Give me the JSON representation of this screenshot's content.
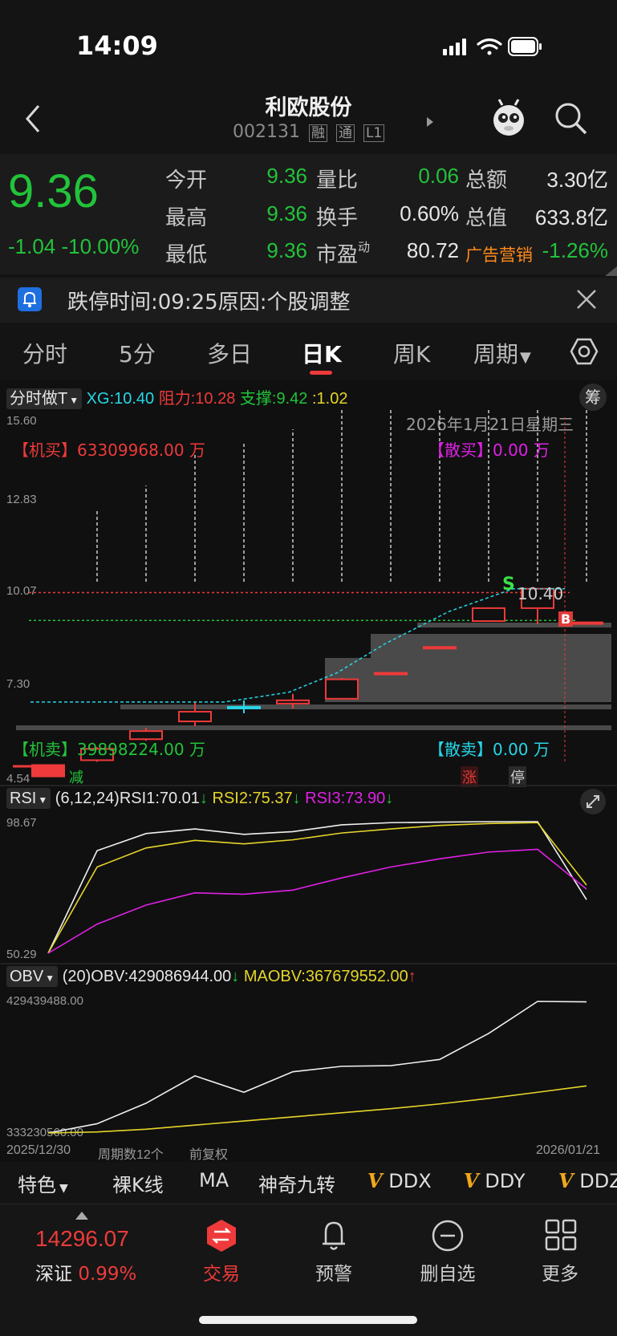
{
  "status_bar": {
    "time": "14:09"
  },
  "header": {
    "title": "利欧股份",
    "code": "002131",
    "tags": [
      "融",
      "通",
      "L1"
    ]
  },
  "quote": {
    "price": "9.36",
    "change": "-1.04",
    "change_pct": "-10.00%",
    "rows": [
      {
        "l1": "今开",
        "v1": "9.36",
        "l2": "量比",
        "v2": "0.06",
        "l3": "总额",
        "v3": "3.30亿"
      },
      {
        "l1": "最高",
        "v1": "9.36",
        "l2": "换手",
        "v2": "0.60%",
        "l3": "总值",
        "v3": "633.8亿"
      },
      {
        "l1": "最低",
        "v1": "9.36",
        "l2": "市盈",
        "l2_sup": "动",
        "v2": "80.72",
        "l3": "广告营销",
        "v3": "-1.26%"
      }
    ]
  },
  "notice": {
    "text": "跌停时间:09:25原因:个股调整"
  },
  "tabs": [
    "分时",
    "5分",
    "多日",
    "日K",
    "周K",
    "周期"
  ],
  "active_tab": "日K",
  "kline": {
    "indicator_select": "分时做T",
    "xg": "XG:10.40",
    "resist": "阻力:10.28",
    "support": "支撑:9.42",
    "ratio": ":1.02",
    "chip_button": "筹",
    "date_label": "2026年1月21日星期三",
    "y_ticks": [
      "15.60",
      "12.83",
      "10.07",
      "7.30",
      "4.54"
    ],
    "inst_buy": "【机买】63309968.00 万",
    "retail_buy": "【散买】0.00 万",
    "inst_sell": "【机卖】39898224.00 万",
    "retail_sell": "【散卖】0.00 万",
    "markers": {
      "s": "S",
      "b": "B",
      "price_tag": "10.40",
      "reduce": "减",
      "rise": "涨",
      "halt": "停"
    }
  },
  "rsi": {
    "select": "RSI",
    "params": "(6,12,24)",
    "rsi1": "RSI1:70.01",
    "rsi2": "RSI2:75.37",
    "rsi3": "RSI3:73.90",
    "y_top": "98.67",
    "y_bottom": "50.29"
  },
  "obv": {
    "select": "OBV",
    "params": "(20)",
    "obv": "OBV:429086944.00",
    "maobv": "MAOBV:367679552.00",
    "y_top": "429439488.00",
    "y_bottom": "333230560.00"
  },
  "x_axis": {
    "start": "2025/12/30",
    "count": "周期数12个",
    "adj": "前复权",
    "end": "2026/01/21"
  },
  "features": [
    "特色",
    "裸K线",
    "MA",
    "神奇九转",
    "DDX",
    "DDY",
    "DDZ"
  ],
  "bottom_bar": {
    "index_value": "14296.07",
    "index_name": "深证",
    "index_pct": "0.99%",
    "items": [
      "交易",
      "预警",
      "删自选",
      "更多"
    ]
  },
  "colors": {
    "up": "#ee3a3a",
    "down": "#22c33a",
    "accent": "#ee3a3a",
    "cyan": "#26d6e8"
  },
  "chart_data": [
    {
      "type": "candlestick",
      "title": "日K",
      "ylim": [
        4.54,
        15.6
      ],
      "candles": [
        {
          "open": 4.95,
          "close": 4.6,
          "high": 4.95,
          "low": 4.6
        },
        {
          "open": 5.1,
          "close": 5.45,
          "high": 5.5,
          "low": 5.05
        },
        {
          "open": 5.75,
          "close": 6.0,
          "high": 6.1,
          "low": 5.7
        },
        {
          "open": 6.3,
          "close": 6.6,
          "high": 6.9,
          "low": 6.15
        },
        {
          "open": 6.75,
          "close": 6.75,
          "high": 6.95,
          "low": 6.55
        },
        {
          "open": 6.85,
          "close": 6.95,
          "high": 7.15,
          "low": 6.7
        },
        {
          "open": 7.0,
          "close": 7.6,
          "high": 7.65,
          "low": 7.0
        },
        {
          "open": 7.8,
          "close": 7.8,
          "high": 7.8,
          "low": 7.8
        },
        {
          "open": 8.6,
          "close": 8.6,
          "high": 8.6,
          "low": 8.6
        },
        {
          "open": 9.4,
          "close": 9.8,
          "high": 9.8,
          "low": 9.4
        },
        {
          "open": 9.8,
          "close": 10.4,
          "high": 10.4,
          "low": 9.3
        },
        {
          "open": 9.36,
          "close": 9.36,
          "high": 9.36,
          "low": 9.36
        }
      ],
      "lines": {
        "resist": 10.28,
        "support": 9.42,
        "xg": 10.4
      }
    },
    {
      "type": "line",
      "title": "RSI",
      "ylim": [
        50.29,
        98.67
      ],
      "series": [
        {
          "name": "RSI1",
          "values": [
            50.29,
            88,
            94.3,
            96,
            94,
            95,
            97.5,
            98.3,
            98.5,
            98.67,
            98.67,
            70.01
          ]
        },
        {
          "name": "RSI2",
          "values": [
            50.29,
            82,
            89,
            91.8,
            90.5,
            92,
            94.5,
            96,
            97.3,
            98,
            98.3,
            75.37
          ]
        },
        {
          "name": "RSI3",
          "values": [
            50.29,
            61,
            68,
            72.5,
            72,
            73.5,
            78,
            82,
            85,
            87.5,
            88.5,
            73.9
          ]
        }
      ]
    },
    {
      "type": "line",
      "title": "OBV",
      "ylim": [
        333230560.0,
        429439488.0
      ],
      "series": [
        {
          "name": "OBV",
          "values": [
            333230560,
            340000000,
            355000000,
            375000000,
            363000000,
            378000000,
            382000000,
            382500000,
            387000000,
            406000000,
            429439488,
            429086944
          ]
        },
        {
          "name": "MAOBV",
          "values": [
            333230560,
            334000000,
            336000000,
            339000000,
            342000000,
            345000000,
            348000000,
            351000000,
            354500000,
            358500000,
            363000000,
            367679552
          ]
        }
      ]
    }
  ]
}
